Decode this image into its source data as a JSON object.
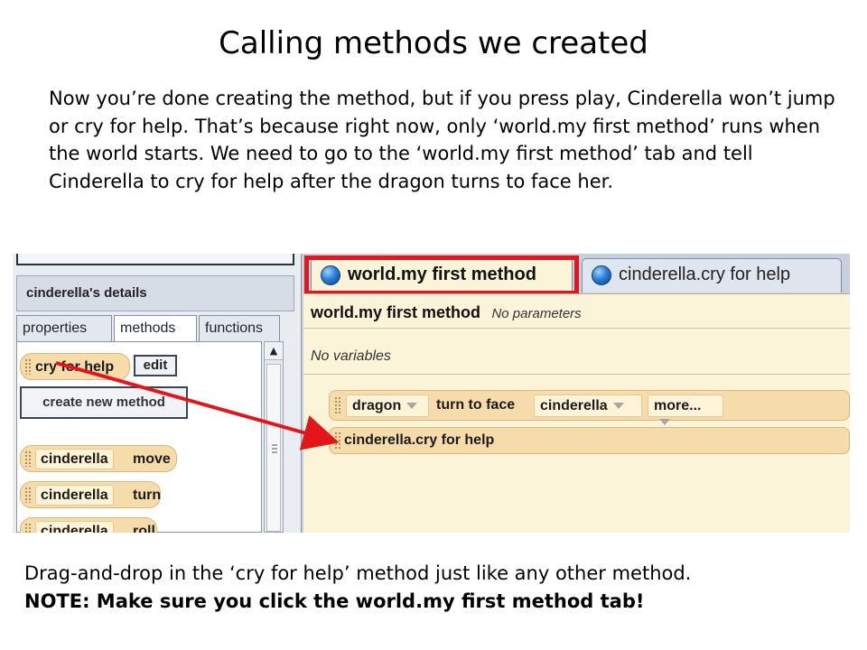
{
  "slide": {
    "title": "Calling methods we created",
    "intro": "Now you’re done creating the method, but if you press play, Cinderella won’t jump or cry for help. That’s because right now, only ‘world.my first method’ runs when the world starts. We need to go to the ‘world.my first method’ tab and tell Cinderella to cry for help after the dragon turns to face her.",
    "footer_text": "Drag-and-drop in the ‘cry for help’ method just like any other method.",
    "footer_note": "NOTE: Make sure you click the world.my first method tab!"
  },
  "details_panel": {
    "header": "cinderella's details",
    "tabs": [
      "properties",
      "methods",
      "functions"
    ],
    "active_tab": "methods",
    "custom_method": "cry for help",
    "edit_label": "edit",
    "create_label": "create new method",
    "builtin_methods": [
      {
        "object": "cinderella",
        "method": "move"
      },
      {
        "object": "cinderella",
        "method": "turn"
      },
      {
        "object": "cinderella",
        "method": "roll"
      }
    ]
  },
  "editor": {
    "tabs": [
      "world.my first method",
      "cinderella.cry for help"
    ],
    "active_tab": "world.my first method",
    "method_name": "world.my first method",
    "params": "No parameters",
    "variables": "No variables",
    "statement1": {
      "object": "dragon",
      "action": "turn to face",
      "target": "cinderella",
      "more": "more..."
    },
    "statement2": "cinderella.cry for help"
  },
  "colors": {
    "highlight": "#e3171b",
    "arrow": "#e3171b",
    "block": "#f6dcaa",
    "editor_bg": "#fbf4d8"
  }
}
